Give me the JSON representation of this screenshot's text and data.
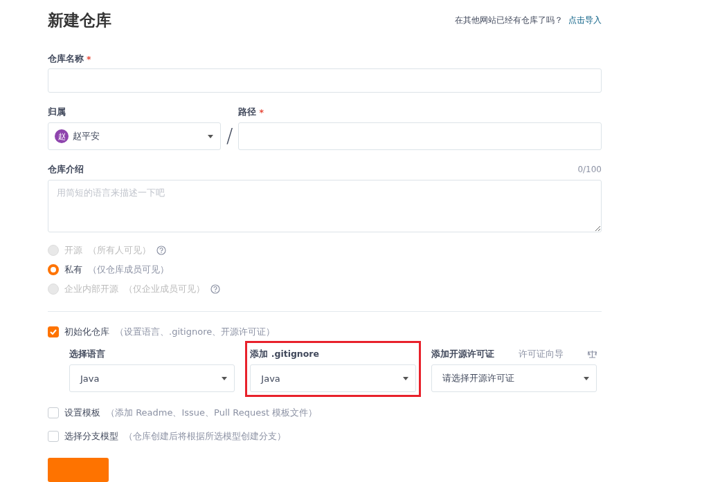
{
  "header": {
    "title": "新建仓库",
    "import_prompt": "在其他网站已经有仓库了吗？",
    "import_link": "点击导入"
  },
  "name_field": {
    "label": "仓库名称",
    "mark": "*"
  },
  "owner": {
    "label": "归属",
    "avatar": "赵",
    "value": "赵平安"
  },
  "separator": "/",
  "path_field": {
    "label": "路径",
    "mark": "*"
  },
  "description": {
    "label": "仓库介绍",
    "counter": "0/100",
    "placeholder": "用简短的语言来描述一下吧"
  },
  "visibility": [
    {
      "label": "开源",
      "hint": "（所有人可见）",
      "selected": false,
      "disabled": true,
      "help": true
    },
    {
      "label": "私有",
      "hint": "（仅仓库成员可见）",
      "selected": true,
      "disabled": false,
      "help": false
    },
    {
      "label": "企业内部开源",
      "hint": "（仅企业成员可见）",
      "selected": false,
      "disabled": true,
      "help": true
    }
  ],
  "init": {
    "label": "初始化仓库",
    "hint": "（设置语言、.gitignore、开源许可证）",
    "checked": true,
    "selects": [
      {
        "label": "选择语言",
        "value": "Java",
        "highlighted": false
      },
      {
        "label": "添加 .gitignore",
        "value": "Java",
        "highlighted": true
      },
      {
        "label": "添加开源许可证",
        "value": "请选择开源许可证",
        "link": "许可证向导",
        "highlighted": false
      }
    ]
  },
  "options": [
    {
      "label": "设置模板",
      "hint": "（添加 Readme、Issue、Pull Request 模板文件）",
      "checked": false
    },
    {
      "label": "选择分支模型",
      "hint": "（仓库创建后将根据所选模型创建分支）",
      "checked": false
    }
  ]
}
